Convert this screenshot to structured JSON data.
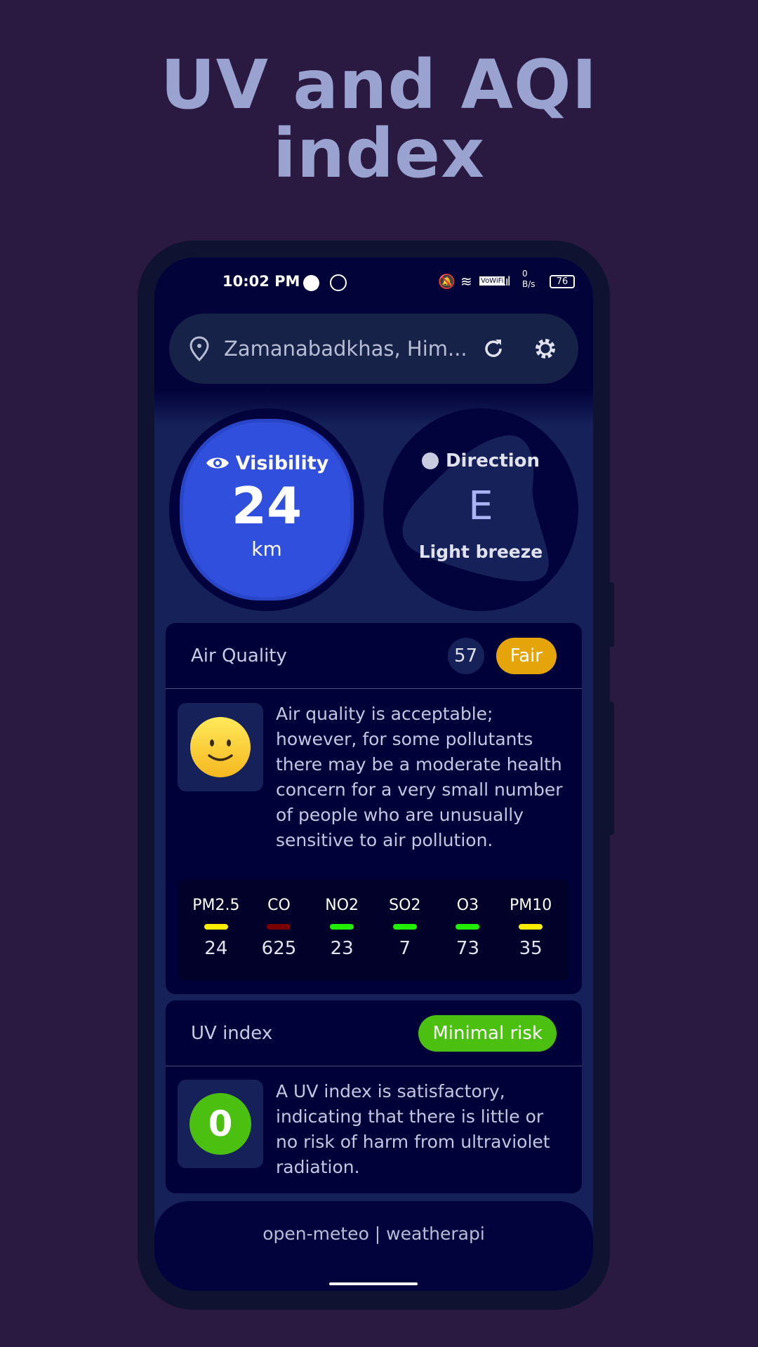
{
  "headline": {
    "line1": "UV and AQI",
    "line2": "index"
  },
  "status_bar": {
    "time": "10:02 PM",
    "network_speed_value": "0",
    "network_speed_unit": "B/s",
    "vowifi": "VoWiFi",
    "battery": "76"
  },
  "search": {
    "location": "Zamanabadkhas, Him..."
  },
  "visibility": {
    "label": "Visibility",
    "value": "24",
    "unit": "km"
  },
  "direction": {
    "label": "Direction",
    "value": "E",
    "description": "Light breeze"
  },
  "air_quality": {
    "title": "Air Quality",
    "index": "57",
    "level": "Fair",
    "level_color": "#e5a50a",
    "description": "Air quality is acceptable; however, for some pollutants there may be a moderate health concern for a very small number of people who are unusually sensitive to air pollution.",
    "pollutants": [
      {
        "name": "PM2.5",
        "value": "24",
        "color": "#ffee00"
      },
      {
        "name": "CO",
        "value": "625",
        "color": "#7a0000"
      },
      {
        "name": "NO2",
        "value": "23",
        "color": "#22ee00"
      },
      {
        "name": "SO2",
        "value": "7",
        "color": "#22ee00"
      },
      {
        "name": "O3",
        "value": "73",
        "color": "#22ee00"
      },
      {
        "name": "PM10",
        "value": "35",
        "color": "#ffee00"
      }
    ]
  },
  "uv": {
    "title": "UV index",
    "level": "Minimal risk",
    "value": "0",
    "level_color": "#4cc010",
    "description": "A UV index is satisfactory, indicating that there is little or no risk of harm from ultraviolet radiation."
  },
  "footer": {
    "text": "open-meteo | weatherapi"
  }
}
